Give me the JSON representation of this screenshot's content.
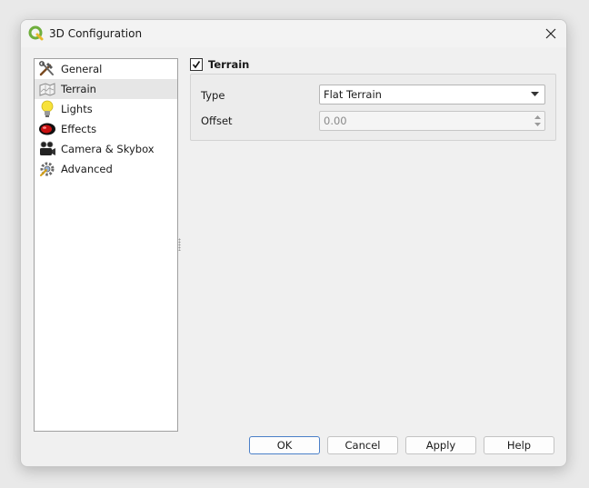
{
  "window": {
    "title": "3D Configuration"
  },
  "sidebar": {
    "items": [
      {
        "label": "General",
        "icon": "tools-icon"
      },
      {
        "label": "Terrain",
        "icon": "terrain-map-icon"
      },
      {
        "label": "Lights",
        "icon": "lightbulb-icon"
      },
      {
        "label": "Effects",
        "icon": "effects-icon"
      },
      {
        "label": "Camera & Skybox",
        "icon": "camera-icon"
      },
      {
        "label": "Advanced",
        "icon": "advanced-settings-icon"
      }
    ],
    "selected": "Terrain"
  },
  "terrain": {
    "group_title": "Terrain",
    "enabled": true,
    "type_label": "Type",
    "type_value": "Flat Terrain",
    "offset_label": "Offset",
    "offset_value": "0.00"
  },
  "buttons": {
    "ok": "OK",
    "cancel": "Cancel",
    "apply": "Apply",
    "help": "Help"
  },
  "colors": {
    "accent": "#4a7fc8",
    "selection": "#e6e6e6",
    "qgis_green": "#6fae3c"
  }
}
